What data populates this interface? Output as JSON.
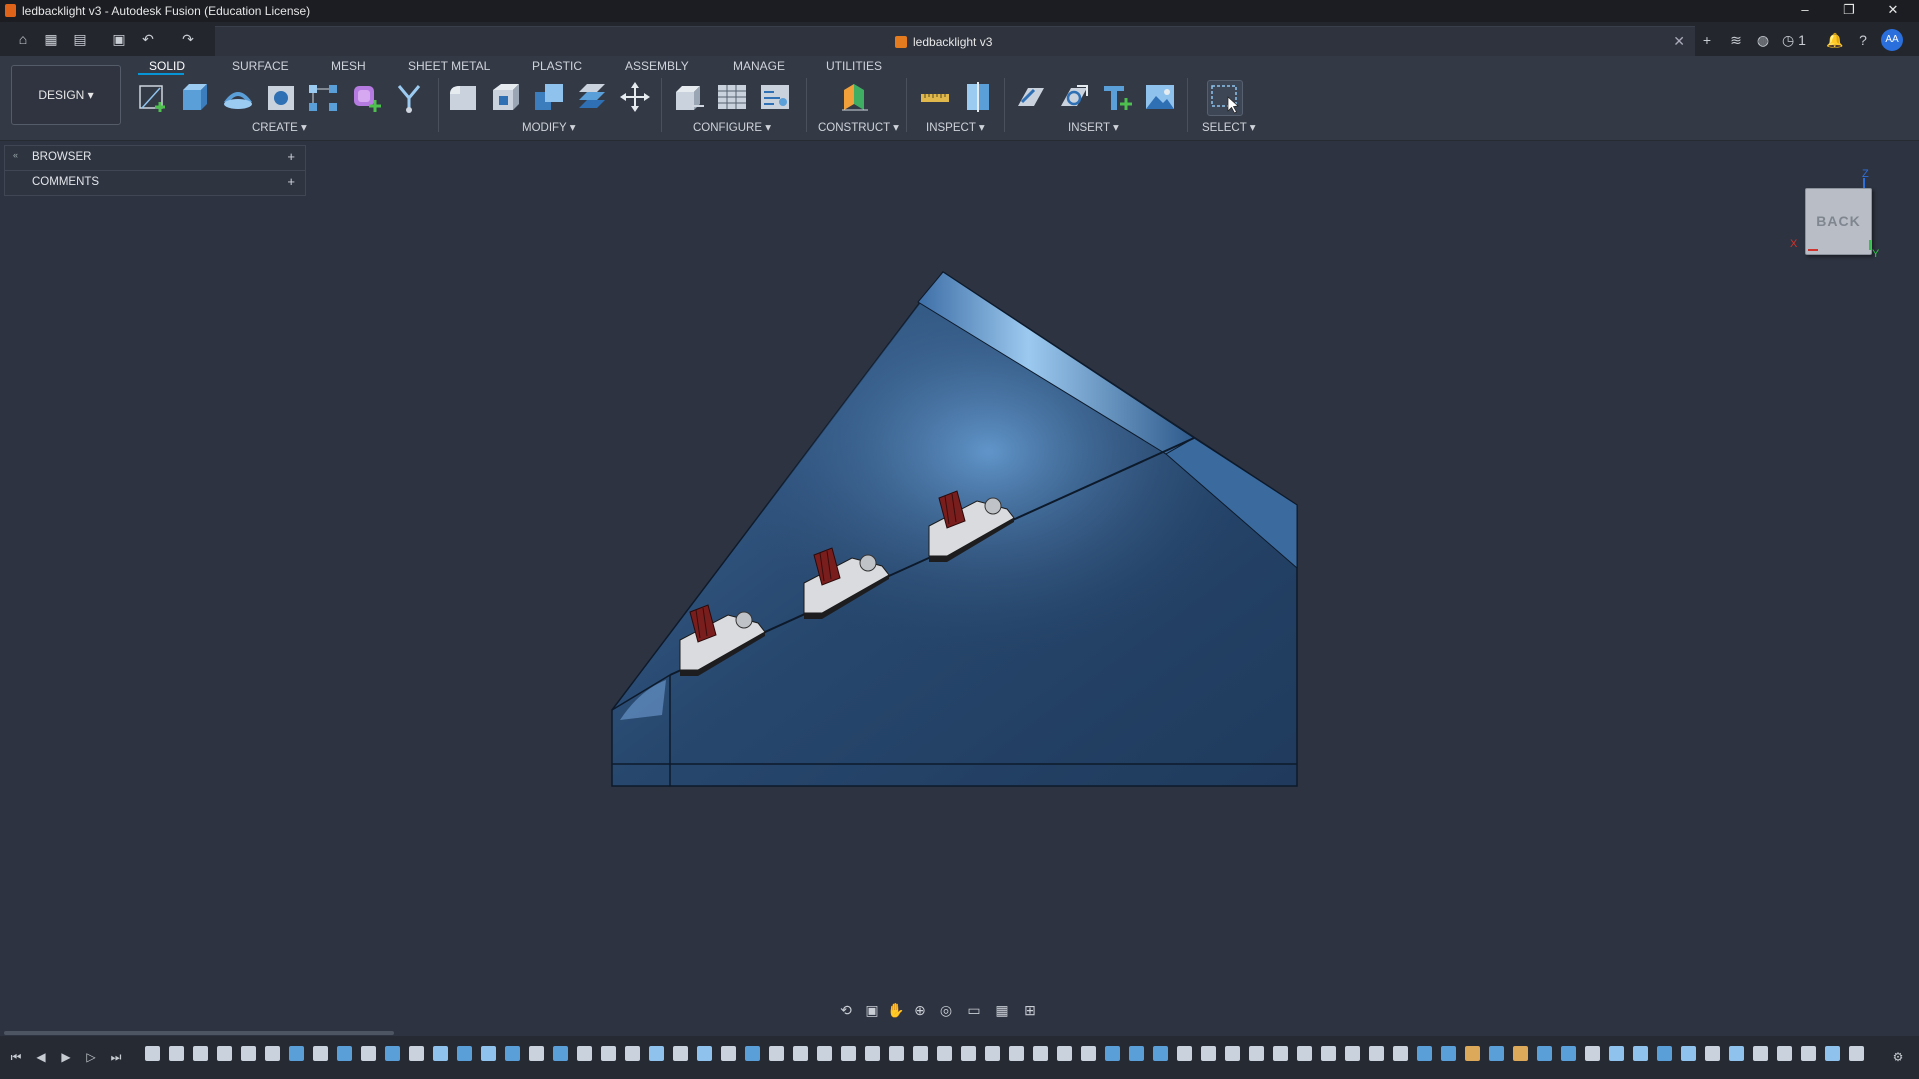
{
  "window": {
    "title": "ledbacklight v3 - Autodesk Fusion (Education License)",
    "minimize": "–",
    "restore": "❐",
    "close": "✕"
  },
  "document": {
    "tab_title": "ledbacklight v3",
    "close": "✕"
  },
  "header": {
    "job_status_count": "1",
    "user_initials": "AA"
  },
  "ribbon": {
    "workspace": "DESIGN ▾",
    "tabs": [
      "SOLID",
      "SURFACE",
      "MESH",
      "SHEET METAL",
      "PLASTIC",
      "ASSEMBLY",
      "MANAGE",
      "UTILITIES"
    ],
    "groups": {
      "create": "CREATE ▾",
      "modify": "MODIFY ▾",
      "configure": "CONFIGURE ▾",
      "construct": "CONSTRUCT ▾",
      "inspect": "INSPECT ▾",
      "insert": "INSERT ▾",
      "select": "SELECT ▾"
    }
  },
  "panels": {
    "browser": "BROWSER",
    "comments": "COMMENTS",
    "plus": "+",
    "collapse": "«"
  },
  "viewcube": {
    "face": "BACK",
    "axes": {
      "x": "X",
      "y": "Y",
      "z": "Z"
    }
  },
  "colors": {
    "accent": "#0696d7",
    "canvas": "#2d3340",
    "model_blue": "#2a4a72",
    "switch_red": "#7a1d1d"
  }
}
